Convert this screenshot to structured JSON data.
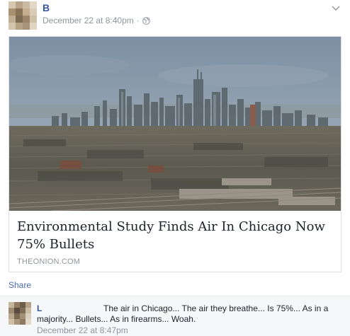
{
  "post": {
    "author": "B",
    "timestamp": "December 22 at 8:40pm",
    "separator": "·",
    "privacy_icon": "globe-icon",
    "menu_icon": "chevron-down-icon"
  },
  "link_card": {
    "image": "chicago-skyline-photo",
    "title": "Environmental Study Finds Air In Chicago Now 75% Bullets",
    "domain": "THEONION.COM"
  },
  "actions": {
    "share_label": "Share"
  },
  "comments": [
    {
      "author": "L",
      "text": "The air in Chicago... The air they breathe... Is 75%... As in a majority... Bullets... As in firearms... Woah.",
      "timestamp": "December 22 at 8:47pm"
    }
  ],
  "colors": {
    "link_blue": "#365899",
    "meta_gray": "#90949c",
    "text_dark": "#1d2129",
    "comment_bg": "#f6f7f9"
  }
}
